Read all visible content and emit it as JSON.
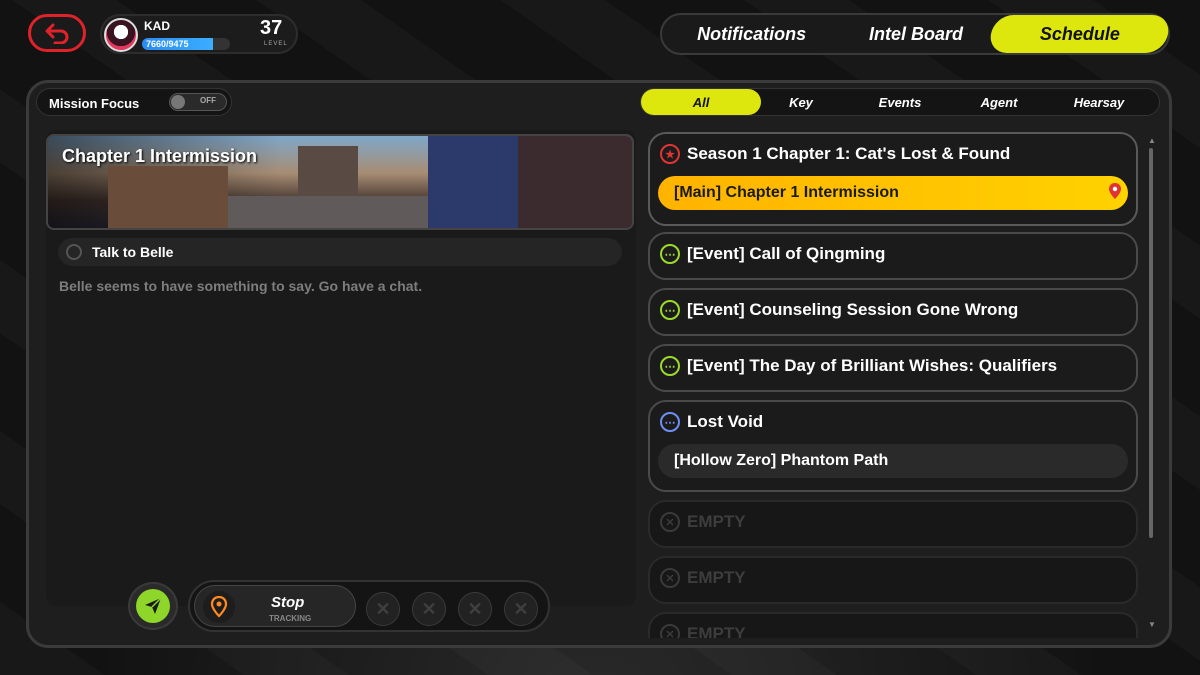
{
  "header": {
    "player_name": "KAD",
    "xp_text": "7660/9475",
    "xp_fraction": 0.81,
    "level": "37",
    "level_label": "LEVEL",
    "tabs": [
      {
        "label": "Notifications",
        "active": false
      },
      {
        "label": "Intel Board",
        "active": false
      },
      {
        "label": "Schedule",
        "active": true
      }
    ]
  },
  "mission_focus": {
    "label": "Mission Focus",
    "toggle_state": "OFF"
  },
  "filters": [
    {
      "label": "All",
      "active": true
    },
    {
      "label": "Key",
      "active": false
    },
    {
      "label": "Events",
      "active": false
    },
    {
      "label": "Agent",
      "active": false
    },
    {
      "label": "Hearsay",
      "active": false
    }
  ],
  "detail": {
    "banner_title": "Chapter 1 Intermission",
    "task_label": "Talk to Belle",
    "description": "Belle seems to have something to say. Go have a chat."
  },
  "tracking": {
    "stop_label": "Stop",
    "sub_label": "TRACKING",
    "empty_slot_glyph": "✕"
  },
  "quests": [
    {
      "icon": "star-icon",
      "title": "Season 1 Chapter 1: Cat's Lost & Found",
      "sub": "[Main] Chapter 1 Intermission"
    },
    {
      "icon": "dots-icon",
      "title": "[Event] Call of Qingming"
    },
    {
      "icon": "dots-icon",
      "title": "[Event] Counseling Session Gone Wrong"
    },
    {
      "icon": "dots-icon",
      "title": "[Event] The Day of Brilliant Wishes: Qualifiers"
    },
    {
      "icon": "dots-icon",
      "title": "Lost Void",
      "sub": "[Hollow Zero] Phantom Path"
    },
    {
      "icon": "empty-icon",
      "title": "EMPTY"
    },
    {
      "icon": "empty-icon",
      "title": "EMPTY"
    },
    {
      "icon": "empty-icon",
      "title": "EMPTY"
    }
  ],
  "colors": {
    "accent_yellow": "#dde70d",
    "main_quest_gold": "#ffc400",
    "back_red": "#e0232a",
    "nav_green": "#8ed62a"
  }
}
